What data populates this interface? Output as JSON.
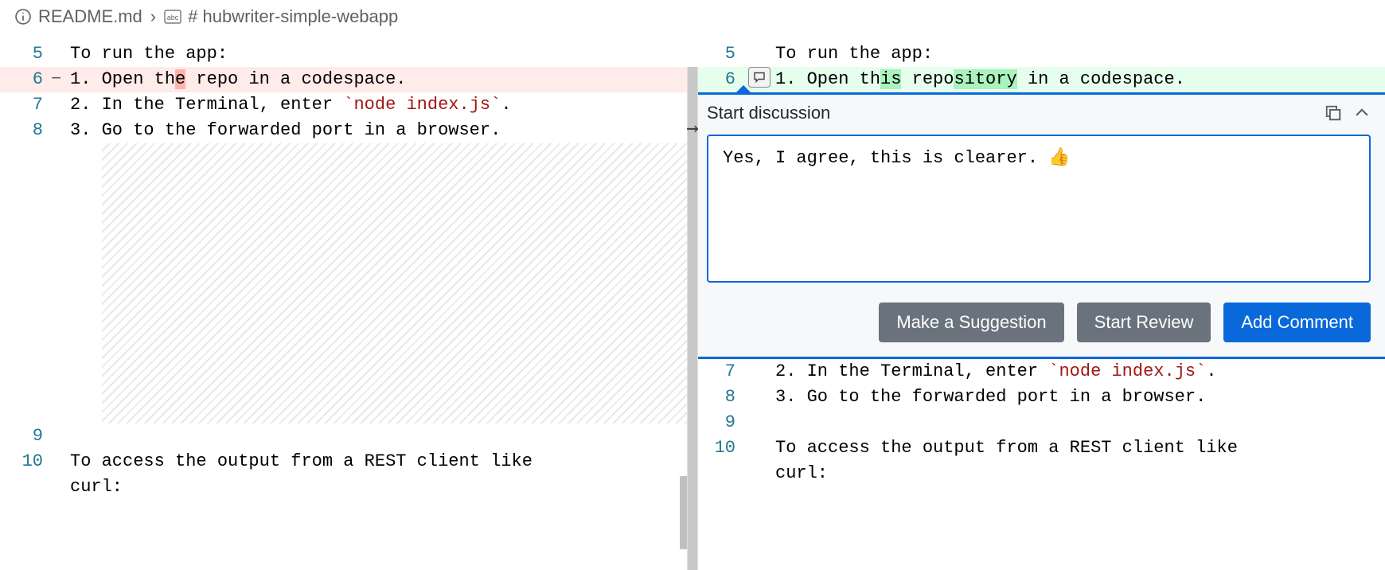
{
  "breadcrumb": {
    "filename": "README.md",
    "heading": "# hubwriter-simple-webapp"
  },
  "left": {
    "lines": [
      {
        "n": "5",
        "marker": "",
        "text": "To run the app:"
      },
      {
        "n": "6",
        "marker": "-",
        "deleted": true,
        "prefix": "1. Open th",
        "del": "e",
        "rest": " repo in a codespace."
      },
      {
        "n": "7",
        "marker": "",
        "text_pre": "2. In the Terminal, enter ",
        "code": "`node index.js`",
        "text_post": "."
      },
      {
        "n": "8",
        "marker": "",
        "text": "3. Go to the forwarded port in a browser."
      },
      {
        "n": "9",
        "marker": "",
        "text": ""
      },
      {
        "n": "10",
        "marker": "",
        "text": "To access the output from a REST client like ",
        "cont": "curl:"
      }
    ]
  },
  "right": {
    "lines_top": [
      {
        "n": "5",
        "text": "To run the app:"
      },
      {
        "n": "6",
        "added": true,
        "prefix": "1. Open th",
        "add1": "is",
        "mid": " repo",
        "add2": "sitory",
        "rest": " in a codespace."
      }
    ],
    "lines_bottom": [
      {
        "n": "7",
        "text_pre": "2. In the Terminal, enter ",
        "code": "`node index.js`",
        "text_post": "."
      },
      {
        "n": "8",
        "text": "3. Go to the forwarded port in a browser."
      },
      {
        "n": "9",
        "text": ""
      },
      {
        "n": "10",
        "text": "To access the output from a REST client like ",
        "cont": "curl:"
      }
    ]
  },
  "discussion": {
    "title": "Start discussion",
    "comment_value": "Yes, I agree, this is clearer. 👍",
    "buttons": {
      "suggestion": "Make a Suggestion",
      "review": "Start Review",
      "add": "Add Comment"
    }
  }
}
